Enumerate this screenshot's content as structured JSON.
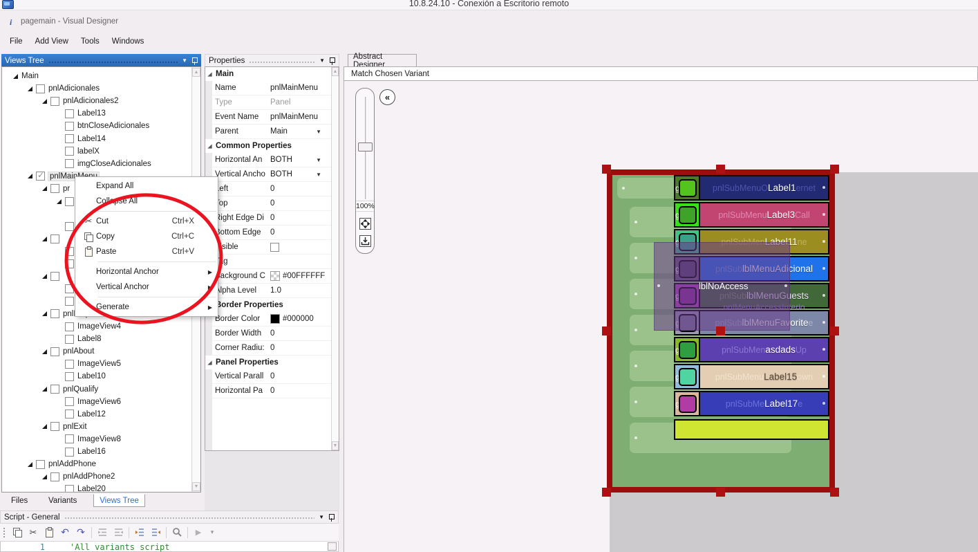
{
  "titlebar": {
    "text": "10.8.24.10 - Conexión a Escritorio remoto"
  },
  "window_title": "pagemain - Visual Designer",
  "menubar": [
    "File",
    "Add View",
    "Tools",
    "Windows"
  ],
  "views_tree": {
    "header": "Views Tree",
    "items": [
      {
        "label": "Main",
        "level": 0,
        "expanded": true
      },
      {
        "label": "pnlAdicionales",
        "level": 1,
        "expanded": true,
        "checkbox": true
      },
      {
        "label": "pnlAdicionales2",
        "level": 2,
        "expanded": true,
        "checkbox": true
      },
      {
        "label": "Label13",
        "level": 3,
        "checkbox": true
      },
      {
        "label": "btnCloseAdicionales",
        "level": 3,
        "checkbox": true
      },
      {
        "label": "Label14",
        "level": 3,
        "checkbox": true
      },
      {
        "label": "labelX",
        "level": 3,
        "checkbox": true
      },
      {
        "label": "imgCloseAdicionales",
        "level": 3,
        "checkbox": true
      },
      {
        "label": "pnlMainMenu",
        "level": 1,
        "expanded": true,
        "checkbox": true,
        "checked": true,
        "selected": true
      },
      {
        "label": "pr",
        "level": 2,
        "expanded": true,
        "checkbox": true
      },
      {
        "label": "",
        "level": 3,
        "expanded": true,
        "checkbox": true
      },
      {
        "label": "",
        "level": 4,
        "checkbox": true
      },
      {
        "label": "",
        "level": 3,
        "checkbox": true
      },
      {
        "label": "",
        "level": 2,
        "expanded": true,
        "checkbox": true
      },
      {
        "label": "",
        "level": 3,
        "checkbox": true
      },
      {
        "label": "",
        "level": 3,
        "checkbox": true
      },
      {
        "label": "",
        "level": 2,
        "expanded": true,
        "checkbox": true
      },
      {
        "label": "",
        "level": 3,
        "checkbox": true
      },
      {
        "label": "",
        "level": 3,
        "checkbox": true
      },
      {
        "label": "pnlHelp",
        "level": 2,
        "expanded": true,
        "checkbox": true
      },
      {
        "label": "ImageView4",
        "level": 3,
        "checkbox": true
      },
      {
        "label": "Label8",
        "level": 3,
        "checkbox": true
      },
      {
        "label": "pnlAbout",
        "level": 2,
        "expanded": true,
        "checkbox": true
      },
      {
        "label": "ImageView5",
        "level": 3,
        "checkbox": true
      },
      {
        "label": "Label10",
        "level": 3,
        "checkbox": true
      },
      {
        "label": "pnlQualify",
        "level": 2,
        "expanded": true,
        "checkbox": true
      },
      {
        "label": "ImageView6",
        "level": 3,
        "checkbox": true
      },
      {
        "label": "Label12",
        "level": 3,
        "checkbox": true
      },
      {
        "label": "pnlExit",
        "level": 2,
        "expanded": true,
        "checkbox": true
      },
      {
        "label": "ImageView8",
        "level": 3,
        "checkbox": true
      },
      {
        "label": "Label16",
        "level": 3,
        "checkbox": true
      },
      {
        "label": "pnlAddPhone",
        "level": 1,
        "expanded": true,
        "checkbox": true
      },
      {
        "label": "pnlAddPhone2",
        "level": 2,
        "expanded": true,
        "checkbox": true
      },
      {
        "label": "Label20",
        "level": 3,
        "checkbox": true
      }
    ],
    "bottom_tabs": [
      {
        "label": "Files",
        "active": false
      },
      {
        "label": "Variants",
        "active": false
      },
      {
        "label": "Views Tree",
        "active": true
      }
    ]
  },
  "context_menu": {
    "items": [
      {
        "label": "Expand All"
      },
      {
        "label": "Collapse All",
        "separator_after": true
      },
      {
        "label": "Cut",
        "icon": "cut-icon",
        "shortcut": "Ctrl+X"
      },
      {
        "label": "Copy",
        "icon": "copy-icon",
        "shortcut": "Ctrl+C"
      },
      {
        "label": "Paste",
        "icon": "paste-icon",
        "shortcut": "Ctrl+V",
        "separator_after": true
      },
      {
        "label": "Horizontal Anchor",
        "submenu": true
      },
      {
        "label": "Vertical Anchor",
        "submenu": true,
        "separator_after": true
      },
      {
        "label": "Generate",
        "submenu": true
      }
    ],
    "annotation_color": "#ec1320"
  },
  "properties": {
    "header": "Properties",
    "groups": [
      {
        "title": "Main",
        "rows": [
          {
            "label": "Name",
            "value": "pnlMainMenu"
          },
          {
            "label": "Type",
            "value": "Panel",
            "disabled": true
          },
          {
            "label": "Event Name",
            "value": "pnlMainMenu"
          },
          {
            "label": "Parent",
            "value": "Main",
            "dropdown": true
          }
        ]
      },
      {
        "title": "Common Properties",
        "rows": [
          {
            "label": "Horizontal An",
            "value": "BOTH",
            "dropdown": true
          },
          {
            "label": "Vertical Ancho",
            "value": "BOTH",
            "dropdown": true
          },
          {
            "label": "Left",
            "value": "0"
          },
          {
            "label": "Top",
            "value": "0"
          },
          {
            "label": "Right Edge Di",
            "value": "0"
          },
          {
            "label": "Bottom Edge",
            "value": "0"
          },
          {
            "label": "Visible",
            "checkbox": true
          },
          {
            "label": "Tag",
            "value": ""
          },
          {
            "label": "Background C",
            "value": "#00FFFFFF",
            "swatch": "checker"
          },
          {
            "label": "Alpha Level",
            "value": "1.0"
          }
        ]
      },
      {
        "title": "Border Properties",
        "rows": [
          {
            "label": "Border Color",
            "value": "#000000",
            "swatch": "#000000"
          },
          {
            "label": "Border Width",
            "value": "0"
          },
          {
            "label": "Corner Radiu:",
            "value": "0"
          }
        ]
      },
      {
        "title": "Panel Properties",
        "rows": [
          {
            "label": "Vertical Parall",
            "value": "0"
          },
          {
            "label": "Horizontal Pa",
            "value": "0"
          }
        ]
      }
    ]
  },
  "designer": {
    "tab": "Abstract Designer",
    "match_bar": "Match Chosen Variant",
    "zoom_label": "100%",
    "collapse_glyph": "«"
  },
  "canvas": {
    "work_area_color": "#cccacc",
    "panel_color": "#7fae72",
    "selection_color": "#9c0d0d",
    "icon_ghost": "geVie",
    "overlay_label": "lblNoAccess",
    "bottom_bar_color": "#cfe532",
    "rows": [
      {
        "ghost_left": "pnlSubMenuO",
        "label": "Label1",
        "ghost_right": "ernet",
        "row_color": "#212a73",
        "ghost_color": "#4c55ae",
        "label_color": "#ffffff",
        "icon_cell_color": "#4d7a28",
        "icon_color": "#52c41d"
      },
      {
        "ghost_left": "pnlSubMenu",
        "label": "Label3",
        "ghost_right": "Call",
        "row_color": "#c24470",
        "ghost_color": "#e089b1",
        "label_color": "#ffffff",
        "icon_cell_color": "#38df1a",
        "icon_color": "#3fa32a"
      },
      {
        "ghost_left": "pnlSubMen",
        "label": "Label11",
        "ghost_right": "ne",
        "row_color": "#9c8d20",
        "ghost_color": "#c0b256",
        "label_color": "#ffffff",
        "icon_cell_color": "#43c287",
        "icon_color": "#3aa189"
      },
      {
        "ghost_left": "pnlSub",
        "label": "lblMenuAdicional",
        "ghost_right": "",
        "row_color": "#1f72e9",
        "ghost_color": "#6d9be2",
        "label_color": "#ffffff",
        "icon_cell_color": "#6a5a80",
        "icon_color": "#55486b"
      },
      {
        "ghost_left": "pnlSub",
        "label": "lblMenuGuests",
        "ghost_right": "",
        "row_color": "#416839",
        "ghost_color": "#7d9a6e",
        "label_color": "#e8e0f5",
        "icon_cell_color": "#b545bb",
        "icon_color": "#8f2f96",
        "extra_line": "pnlMenuAccessInterio"
      },
      {
        "ghost_left": "pnlSub",
        "label": "lblMenuFavorite",
        "ghost_right": "e",
        "row_color": "#7d88a9",
        "ghost_color": "#aab2cb",
        "label_color": "#ffffff",
        "icon_cell_color": "#9a9ab5",
        "icon_color": "#7a7a95"
      },
      {
        "ghost_left": "pnlSubMen",
        "label": "asdads",
        "ghost_right": "Up",
        "row_color": "#5c40af",
        "ghost_color": "#8b75d5",
        "label_color": "#ffffff",
        "icon_cell_color": "#8ab82b",
        "icon_color": "#2e9e40"
      },
      {
        "ghost_left": "pnlSubMenu",
        "label": "Label15",
        "ghost_right": "own",
        "row_color": "#e3cdb3",
        "ghost_color": "#f2e3cd",
        "label_color": "#5c4c3d",
        "icon_cell_color": "#93bdd9",
        "icon_color": "#50d4a1"
      },
      {
        "ghost_left": "pnlSubMe",
        "label": "Label17",
        "ghost_right": "e",
        "row_color": "#373db6",
        "ghost_color": "#6b71d8",
        "label_color": "#ffffff",
        "icon_cell_color": "#dbb79f",
        "icon_color": "#b03ca4"
      }
    ]
  },
  "script_panel": {
    "header": "Script - General",
    "line_number": "1",
    "code": "'All variants script",
    "toolbar_icons": [
      "copy-icon",
      "cut-icon",
      "paste-icon",
      "undo-icon",
      "redo-icon",
      "sep",
      "indent-lines-left-icon",
      "indent-lines-right-icon",
      "sep",
      "outdent-icon",
      "indent-icon",
      "sep",
      "search-icon",
      "sep",
      "run-icon",
      "overflow-chevron-icon"
    ]
  }
}
